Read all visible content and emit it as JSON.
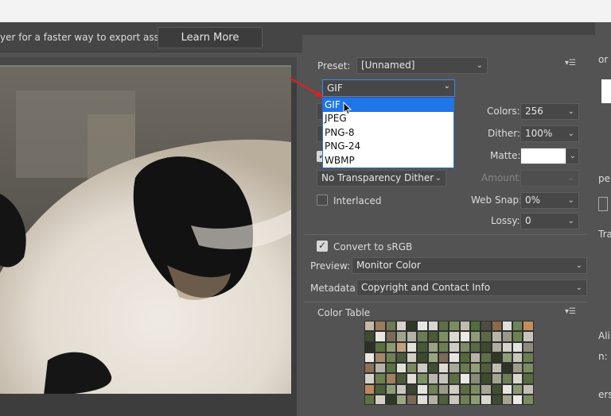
{
  "infobar": {
    "message": "yer for a faster way to export assets",
    "learn_more": "Learn More"
  },
  "preset": {
    "label": "Preset:",
    "value": "[Unnamed]"
  },
  "format": {
    "value": "GIF",
    "options": [
      "GIF",
      "JPEG",
      "PNG-8",
      "PNG-24",
      "WBMP"
    ],
    "highlighted": "GIF"
  },
  "colors": {
    "label": "Colors:",
    "value": "256"
  },
  "dither": {
    "label": "Dither:",
    "value": "100%"
  },
  "matte": {
    "label": "Matte:"
  },
  "amount": {
    "label": "Amount:"
  },
  "transparency_dither": {
    "value": "No Transparency Dither"
  },
  "interlaced": {
    "label": "Interlaced",
    "checked": false
  },
  "web_snap": {
    "label": "Web Snap:",
    "value": "0%"
  },
  "lossy": {
    "label": "Lossy:",
    "value": "0"
  },
  "convert_srgb": {
    "label": "Convert to sRGB",
    "checked": true
  },
  "preview": {
    "label": "Preview:",
    "value": "Monitor Color"
  },
  "metadata": {
    "label": "Metadata:",
    "value": "Copyright and Contact Info"
  },
  "color_table": {
    "label": "Color Table"
  },
  "right_edge": {
    "a": "or",
    "b": "pe",
    "c": "Tra",
    "d": "Ali",
    "e": "n:",
    "f": "ers"
  },
  "palette": [
    "#c8b8a8",
    "#9a7b5e",
    "#6f7a55",
    "#d7d2ca",
    "#2e3a24",
    "#e7e6e2",
    "#d9d6cf",
    "#5f6e48",
    "#7b8e5f",
    "#c3bcae",
    "#506f3c",
    "#4f4c44",
    "#8b6a4a",
    "#e0ded8",
    "#6e8458",
    "#c48e5a",
    "#3d4a2e",
    "#e8e6e1",
    "#7a6c59",
    "#a2a38c",
    "#b4b2a7",
    "#6a7c54",
    "#4a5b37",
    "#7e8f65",
    "#dcd9d2",
    "#ebe9e5",
    "#8f9a7a",
    "#5c6a44",
    "#b8b4a8",
    "#999989",
    "#6d8253",
    "#c5c3bb",
    "#2c2f26",
    "#5b7040",
    "#8a9b70",
    "#c2a27f",
    "#e2e0da",
    "#475838",
    "#9aa484",
    "#6e7f56",
    "#cfccc4",
    "#7d8b66",
    "#5a6946",
    "#3e4a30",
    "#b0ae9f",
    "#d6d3cb",
    "#e5e3dd",
    "#8d8c7c",
    "#e9e7e2",
    "#a48868",
    "#6f8154",
    "#4c5a3a",
    "#d2cec6",
    "#3a4a2b",
    "#98a580",
    "#7c6b57",
    "#e6e4df",
    "#526a3a",
    "#b6b3a6",
    "#5e6f48",
    "#2f3a22",
    "#8f9c78",
    "#c9c6bd",
    "#6b7e52",
    "#8c7058",
    "#b5b3a7",
    "#5a7141",
    "#e3e1dc",
    "#7a8a5f",
    "#cdcac2",
    "#3f5030",
    "#dedbd4",
    "#a7a898",
    "#6a7a51",
    "#90a07a",
    "#515e3e",
    "#c0bdb2",
    "#2d3325",
    "#9d9d8b",
    "#7b8c63",
    "#d5d1c9",
    "#6c8050",
    "#9f815f",
    "#4b5a39",
    "#e2dfd9",
    "#7d9064",
    "#b9b7ab",
    "#c6c3ba",
    "#5d6d45",
    "#eae8e3",
    "#8a8c78",
    "#3c4a2d",
    "#a3a48f",
    "#6d7e55",
    "#d9d6ce",
    "#576b40",
    "#b98a5f",
    "#4d5e39",
    "#8e9d78",
    "#c8c5bc",
    "#3a4430",
    "#e4e2dc",
    "#6f8256",
    "#9b9c88",
    "#d1cdc5",
    "#5b6d43",
    "#7c8d62",
    "#a8a796",
    "#42502f",
    "#e7e5e0",
    "#8b9a74",
    "#c2bfb5",
    "#5e7344",
    "#d3cfc7",
    "#2e3826",
    "#9ca883",
    "#7b6857",
    "#e0ddd7",
    "#b3b1a4",
    "#4f603b",
    "#c9c5bc",
    "#6e8053",
    "#8d9b76",
    "#dad7d0",
    "#3f4b31",
    "#a5a592",
    "#eceae5",
    "#7a8c61"
  ]
}
